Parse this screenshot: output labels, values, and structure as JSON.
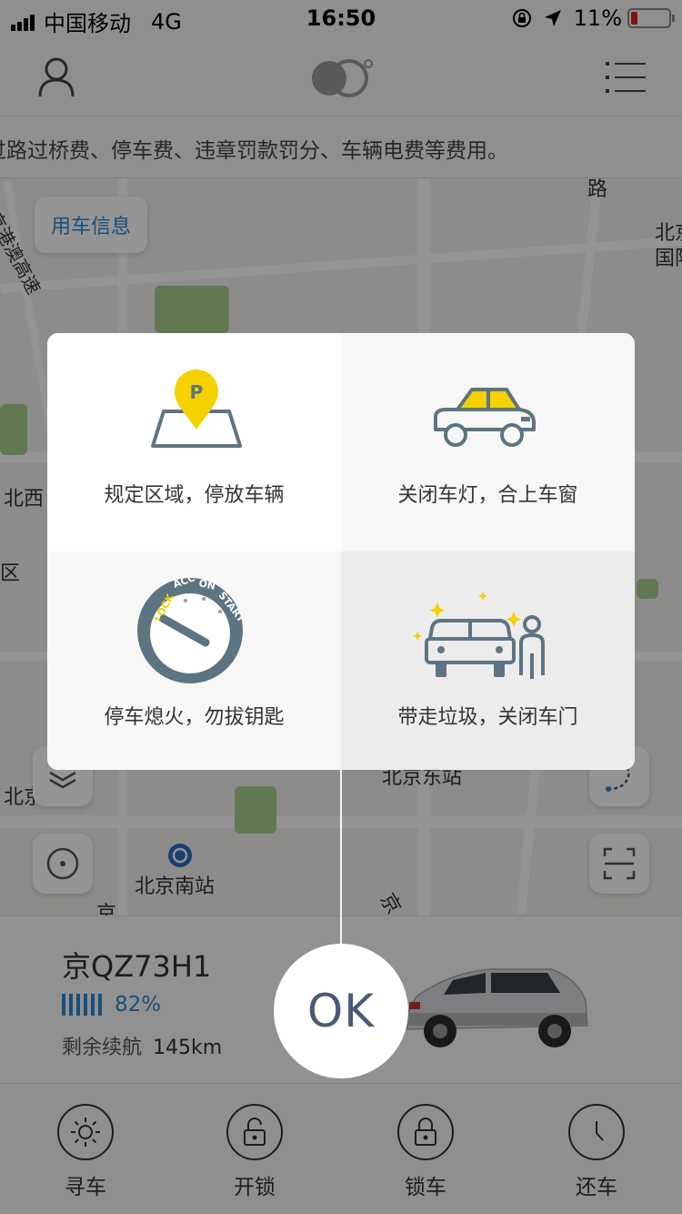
{
  "status_bar": {
    "carrier": "中国移动",
    "network": "4G",
    "time": "16:50",
    "battery_percent": "11%"
  },
  "notice": {
    "text": "过路过桥费、停车费、违章罚款罚分、车辆电费等费用。"
  },
  "map": {
    "car_info_button": "用车信息",
    "labels": {
      "highway": "京港澳高速",
      "road": "路",
      "beijing_top": "北京",
      "beijing_top2": "国际",
      "beijing_west": "北西",
      "district": "区",
      "beijing_east_station": "北京东站",
      "beijing_left": "北京",
      "beijing_south_station": "北京南站",
      "jing1": "京",
      "jing2": "京"
    }
  },
  "tips_modal": {
    "tips": [
      {
        "label": "规定区域，停放车辆",
        "icon": "parking-location-icon"
      },
      {
        "label": "关闭车灯，合上车窗",
        "icon": "car-window-icon"
      },
      {
        "label": "停车熄火，勿拔钥匙",
        "icon": "ignition-key-icon"
      },
      {
        "label": "带走垃圾，关闭车门",
        "icon": "clean-car-icon"
      }
    ],
    "ignition_dial_labels": {
      "lock": "LOCK",
      "acc": "ACC",
      "on": "ON",
      "start": "START"
    },
    "parking_pin_letter": "P"
  },
  "ok_button": {
    "label": "OK"
  },
  "vehicle": {
    "plate": "京QZ73H1",
    "battery": "82%",
    "range_label": "剩余续航",
    "range_value": "145km"
  },
  "tab_bar": {
    "items": [
      {
        "label": "寻车",
        "icon": "sun-icon"
      },
      {
        "label": "开锁",
        "icon": "unlock-icon"
      },
      {
        "label": "锁车",
        "icon": "lock-icon"
      },
      {
        "label": "还车",
        "icon": "clock-icon"
      }
    ]
  },
  "colors": {
    "accent_blue": "#2b8ad3",
    "icon_slate": "#5d7482",
    "yellow": "#f5d100",
    "ok_text": "#4a5a74"
  }
}
